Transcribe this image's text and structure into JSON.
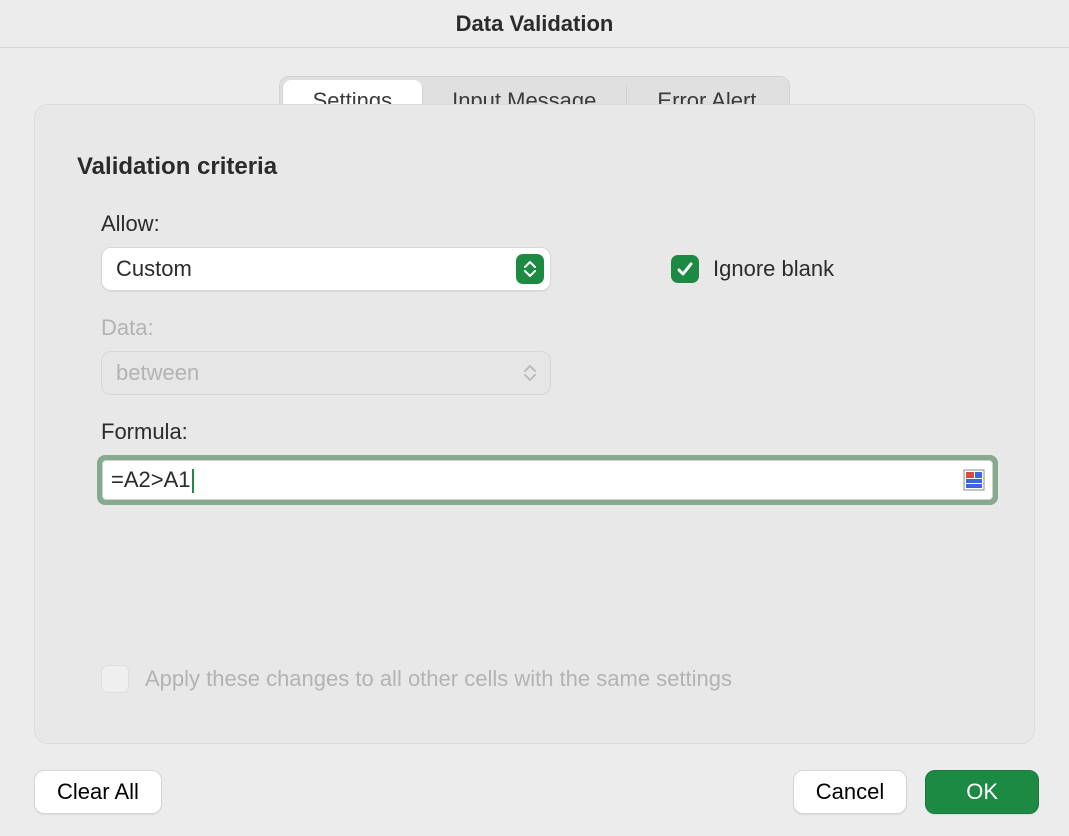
{
  "title": "Data Validation",
  "tabs": {
    "settings": "Settings",
    "input_message": "Input Message",
    "error_alert": "Error Alert",
    "active": "settings"
  },
  "section": {
    "heading": "Validation criteria",
    "allow_label": "Allow:",
    "allow_value": "Custom",
    "ignore_blank_label": "Ignore blank",
    "ignore_blank_checked": true,
    "data_label": "Data:",
    "data_value": "between",
    "data_enabled": false,
    "formula_label": "Formula:",
    "formula_value": "=A2>A1",
    "apply_all_label": "Apply these changes to all other cells with the same settings",
    "apply_all_checked": false,
    "apply_all_enabled": false
  },
  "buttons": {
    "clear_all": "Clear All",
    "cancel": "Cancel",
    "ok": "OK"
  },
  "colors": {
    "accent": "#1d8a44"
  }
}
